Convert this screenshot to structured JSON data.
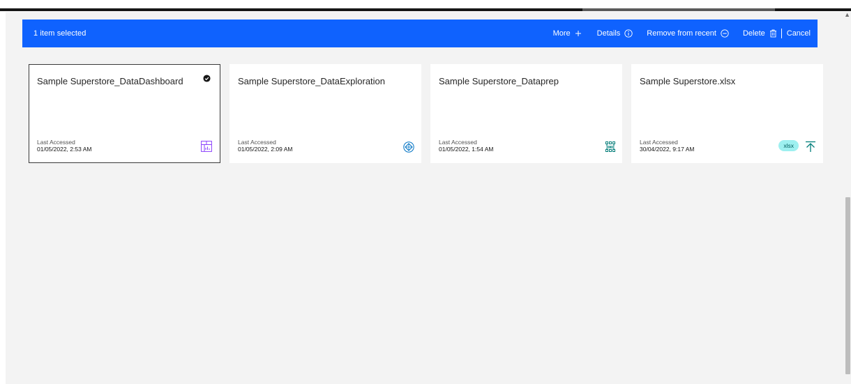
{
  "action_bar": {
    "selection_text": "1 item selected",
    "more_label": "More",
    "details_label": "Details",
    "remove_label": "Remove from recent",
    "delete_label": "Delete",
    "cancel_label": "Cancel",
    "color": "#0f62fe"
  },
  "tiles": [
    {
      "title": "Sample Superstore_DataDashboard",
      "meta_label": "Last Accessed",
      "meta_value": "01/05/2022, 2:53 AM",
      "icon": "dashboard-icon",
      "selected": true
    },
    {
      "title": "Sample Superstore_DataExploration",
      "meta_label": "Last Accessed",
      "meta_value": "01/05/2022, 2:09 AM",
      "icon": "exploration-icon",
      "selected": false
    },
    {
      "title": "Sample Superstore_Dataprep",
      "meta_label": "Last Accessed",
      "meta_value": "01/05/2022, 1:54 AM",
      "icon": "data-module-icon",
      "selected": false
    },
    {
      "title": "Sample Superstore.xlsx",
      "meta_label": "Last Accessed",
      "meta_value": "30/04/2022, 9:17 AM",
      "badge": "xlsx",
      "icon": "upload-icon",
      "selected": false
    }
  ]
}
